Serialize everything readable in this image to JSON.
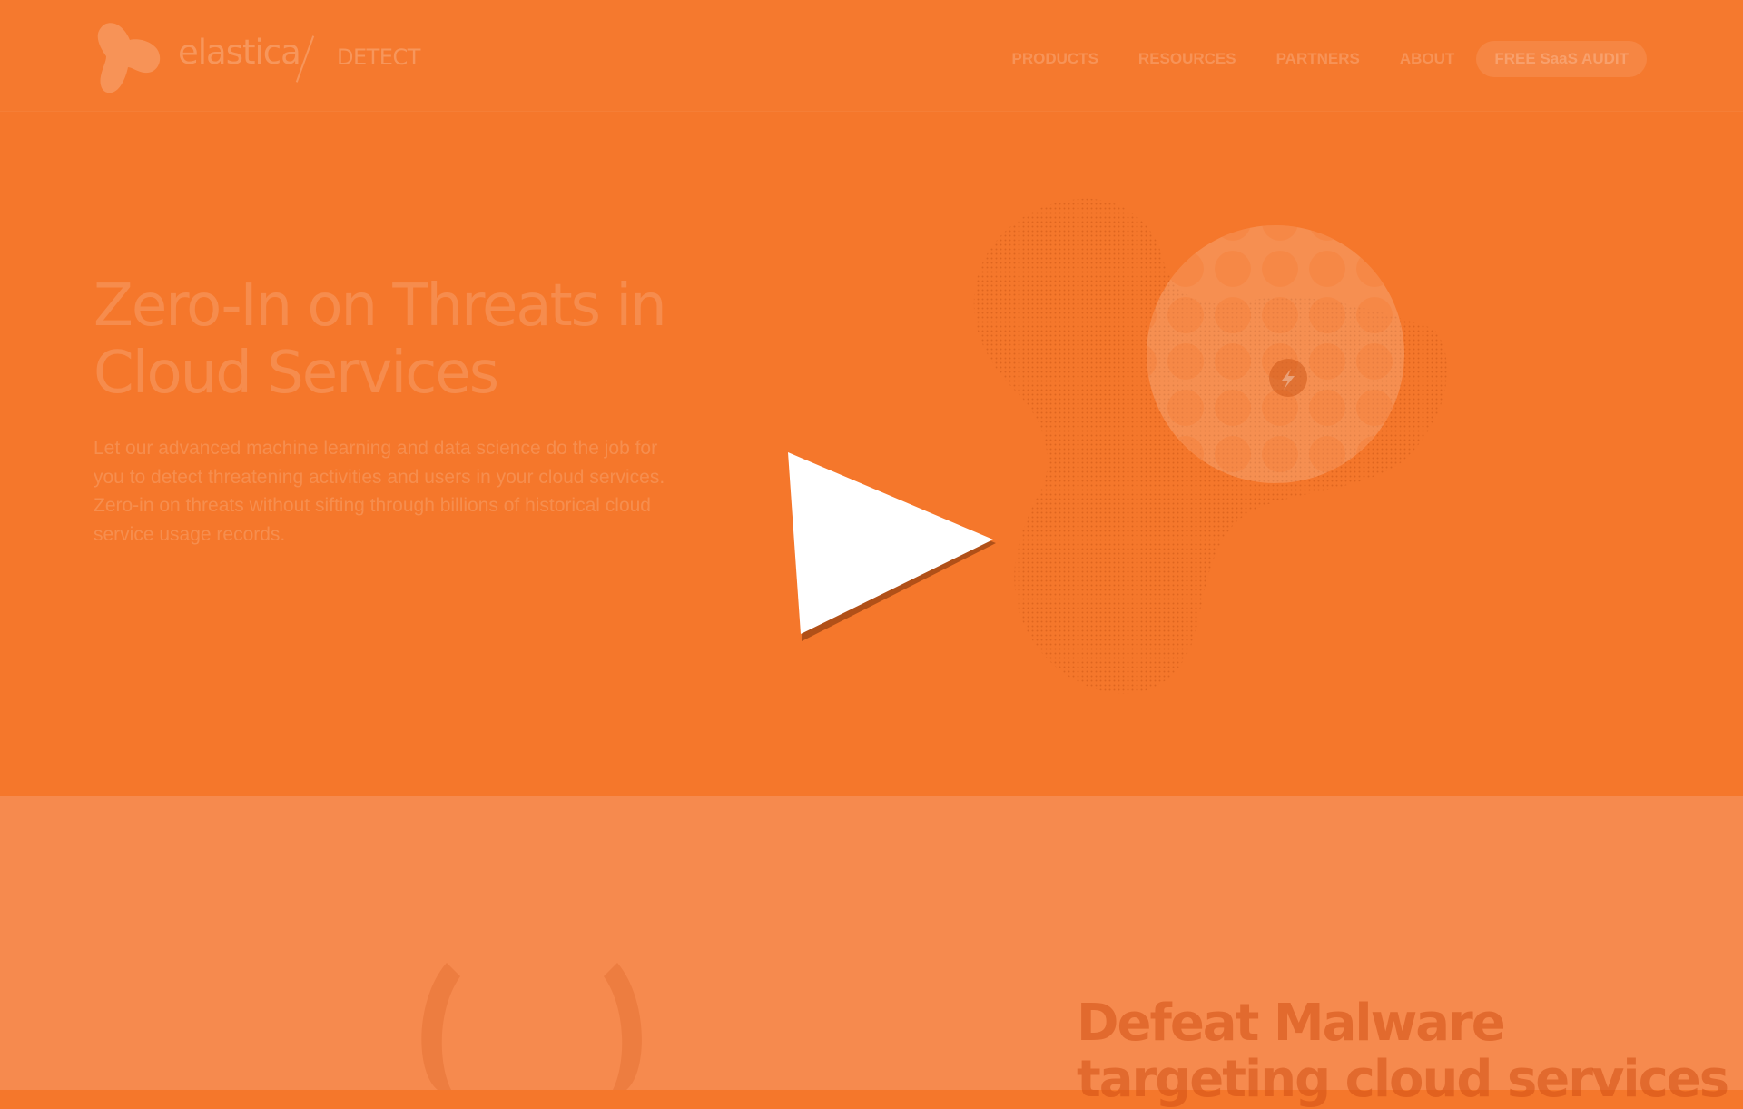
{
  "brand": {
    "logo_word": "elastica",
    "product": "DETECT"
  },
  "nav": {
    "items": [
      {
        "label": "PRODUCTS"
      },
      {
        "label": "RESOURCES"
      },
      {
        "label": "PARTNERS"
      },
      {
        "label": "ABOUT"
      }
    ],
    "cta_label": "FREE SaaS AUDIT"
  },
  "hero": {
    "title_line1": "Zero-In on Threats in",
    "title_line2": "Cloud Services",
    "description": "Let our advanced machine learning and data science do the job for you to detect threatening activities and users in your cloud services. Zero-in on threats without sifting through billions of historical cloud service usage records."
  },
  "section2": {
    "title_line1": "Defeat Malware",
    "title_line2": "targeting cloud services"
  },
  "colors": {
    "hero_bg": "#f5772b",
    "section2_bg": "#f68a4e",
    "play_icon": "#ffffff"
  }
}
